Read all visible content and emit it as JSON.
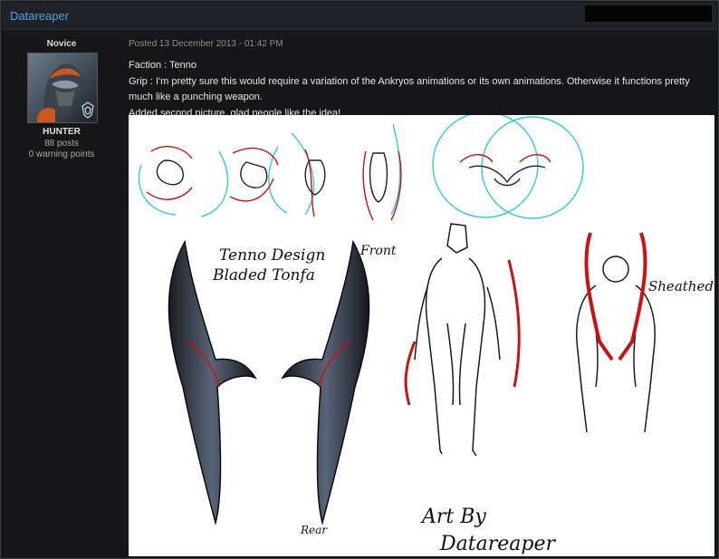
{
  "header": {
    "author": "Datareaper"
  },
  "sidebar": {
    "rank": "Novice",
    "avatar_alt": "Warframe avatar",
    "title": "HUNTER",
    "posts": "88 posts",
    "warnings": "0 warning points"
  },
  "post": {
    "meta": "Posted 13 December 2013 - 01:42 PM",
    "lines": [
      "Faction : Tenno",
      "Grip : I'm pretty sure this would require a variation of the Ankryos animations or its own animations.  Otherwise it functions pretty much like a punching weapon.",
      "Added second picture, glad people like the idea!"
    ],
    "artwork_labels": {
      "title1": "Tenno Design",
      "title2": "Bladed Tonfa",
      "front": "Front",
      "rear": "Rear",
      "sheathed": "Sheathed",
      "signature1": "Art By",
      "signature2": "Datareaper"
    }
  },
  "colors": {
    "accent": "#4fa3e6",
    "sketch_red": "#cc1111",
    "sketch_cyan": "#33cccc"
  }
}
